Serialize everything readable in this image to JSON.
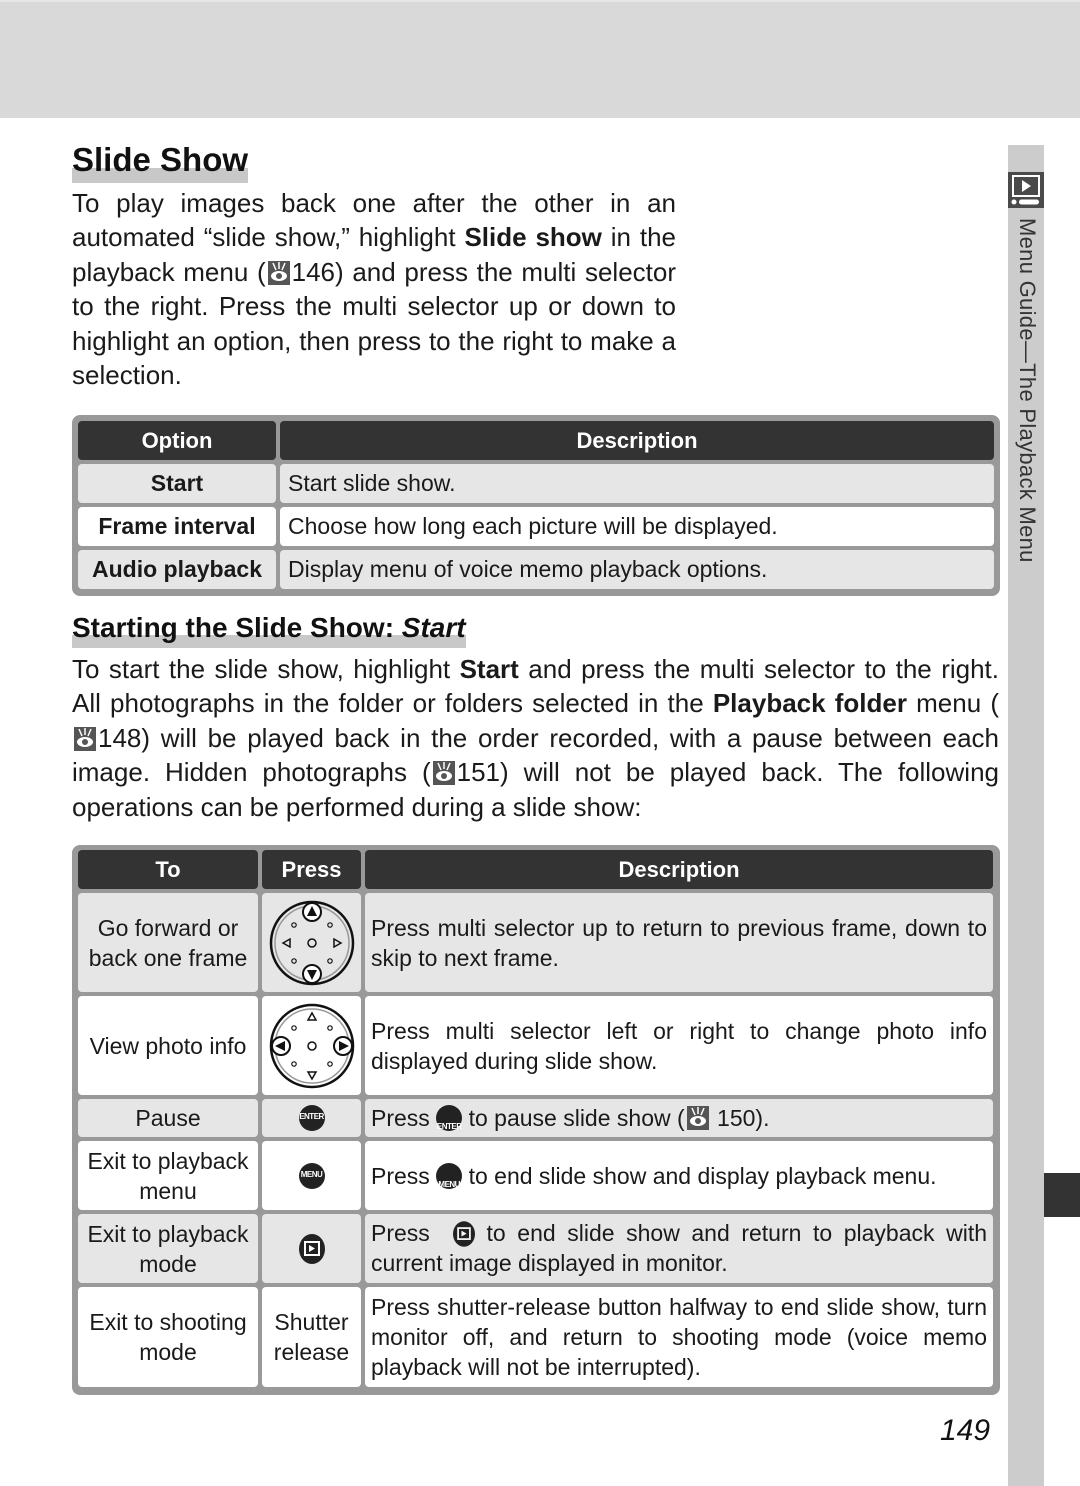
{
  "side_tab": {
    "icon": "playback-icon",
    "label_part1": "Menu Guide",
    "label_dash": "—",
    "label_part2": "The Playback Menu"
  },
  "title": "Slide Show",
  "intro": {
    "text1": "To play images back one after the other in an automated “slide show,” highlight ",
    "bold1": "Slide show",
    "text2": " in the playback menu (",
    "ref_icon": "reference-eye-icon",
    "ref_page": "146",
    "text3": ") and press the multi selector to the right.  Press the multi selector up or down to highlight an option, then press to the right to make a selection."
  },
  "options_table": {
    "headers": [
      "Option",
      "Description"
    ],
    "rows": [
      {
        "option": "Start",
        "description": "Start slide show."
      },
      {
        "option": "Frame interval",
        "description": "Choose how long each picture will be displayed."
      },
      {
        "option": "Audio playback",
        "description": "Display menu of voice memo playback options."
      }
    ]
  },
  "subtitle": {
    "text": "Starting the Slide Show: ",
    "italic": "Start"
  },
  "body2": {
    "t1": "To start the slide show, highlight ",
    "b1": "Start",
    "t2": " and press the multi selector to the right.  All photographs in the folder or folders selected in the ",
    "b2": "Playback folder",
    "t3": " menu (",
    "ref1": "148",
    "t4": ") will be played back in the order recorded, with a pause between each image.  Hidden photographs (",
    "ref2": "151",
    "t5": ") will not be played back. The following operations can be performed during a slide show:"
  },
  "ops_table": {
    "headers": [
      "To",
      "Press",
      "Description"
    ],
    "rows": [
      {
        "to": "Go forward or back one frame",
        "press_icon": "multi-selector-up-down-icon",
        "description": "Press multi selector up to return to previous frame, down to skip to next frame."
      },
      {
        "to": "View photo info",
        "press_icon": "multi-selector-left-right-icon",
        "description": "Press multi selector left or right to change photo info displayed during slide show."
      },
      {
        "to": "Pause",
        "press_icon": "enter-button-icon",
        "press_label": "ENTER",
        "d1": "Press ",
        "d2": " to pause slide show (",
        "ref": "150",
        "d3": ")."
      },
      {
        "to": "Exit to playback menu",
        "press_icon": "menu-button-icon",
        "press_label": "MENU",
        "d1": "Press ",
        "d2": " to end slide show and display playback menu."
      },
      {
        "to": "Exit to playback mode",
        "press_icon": "playback-button-icon",
        "d1": "Press ",
        "d2": " to end slide show and return to playback with current image displayed in monitor."
      },
      {
        "to": "Exit to shooting mode",
        "press_text": "Shutter release",
        "description": "Press shutter-release button halfway to end slide show, turn monitor off, and return to shooting mode (voice memo playback will not be interrupted)."
      }
    ]
  },
  "page_number": "149"
}
